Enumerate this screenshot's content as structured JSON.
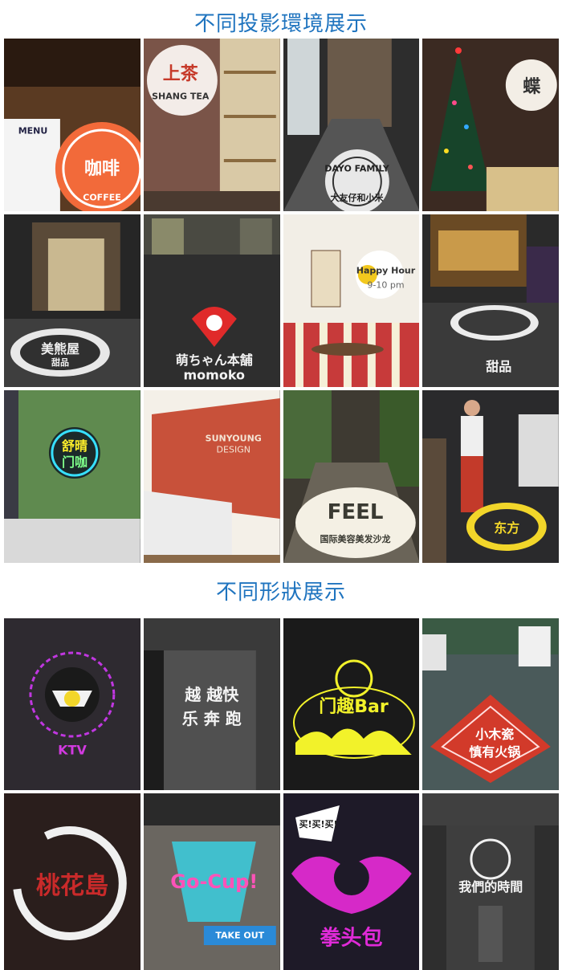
{
  "titles": {
    "env": "不同投影環境展示",
    "shape": "不同形狀展示"
  },
  "env_tiles": [
    {
      "name": "coffee-shop",
      "menu": "MENU",
      "logo": "咖啡",
      "sub": "COFFEE"
    },
    {
      "name": "tea-shop",
      "logo": "上茶",
      "sub": "SHANG TEA"
    },
    {
      "name": "mall-corridor",
      "logo": "DAYO FAMILY",
      "sub": "大友仔和小米",
      "arc": "大友仔和小米"
    },
    {
      "name": "christmas-tree",
      "logo": "蝶"
    },
    {
      "name": "shop-entrance",
      "logo": "美熊屋",
      "sub": "甜品"
    },
    {
      "name": "street-night",
      "logo": "萌ちゃん本舗",
      "sub": "momoko"
    },
    {
      "name": "cafe-wall",
      "logo": "Happy Hour",
      "sub": "9-10 pm"
    },
    {
      "name": "dessert-bar",
      "logo": "甜品"
    },
    {
      "name": "green-wall",
      "logo": "舒晴",
      "sub": "门咖"
    },
    {
      "name": "office-lobby",
      "logo": "SUNYOUNG",
      "sub": "DESIGN"
    },
    {
      "name": "beauty-salon",
      "logo": "FEEL",
      "sub": "国际美容美发沙龙"
    },
    {
      "name": "woman-standing",
      "logo": "东方"
    }
  ],
  "shape_tiles": [
    {
      "name": "ktv-floor",
      "logo": "KTV"
    },
    {
      "name": "running-wall",
      "logo": "越 越快乐 奔 跑"
    },
    {
      "name": "bar-wall",
      "logo": "门趣Bar"
    },
    {
      "name": "hotpot-floor",
      "logo": "小木瓷",
      "sub": "慎有火锅"
    },
    {
      "name": "peach-island",
      "logo": "桃花島"
    },
    {
      "name": "go-cup",
      "logo": "Go-Cup!",
      "sub": "TAKE OUT"
    },
    {
      "name": "fist-logo",
      "logo": "拳头包",
      "sub": "买!买!买!"
    },
    {
      "name": "our-time",
      "logo": "我們的時間"
    }
  ],
  "colors": {
    "title": "#1f74bf"
  }
}
